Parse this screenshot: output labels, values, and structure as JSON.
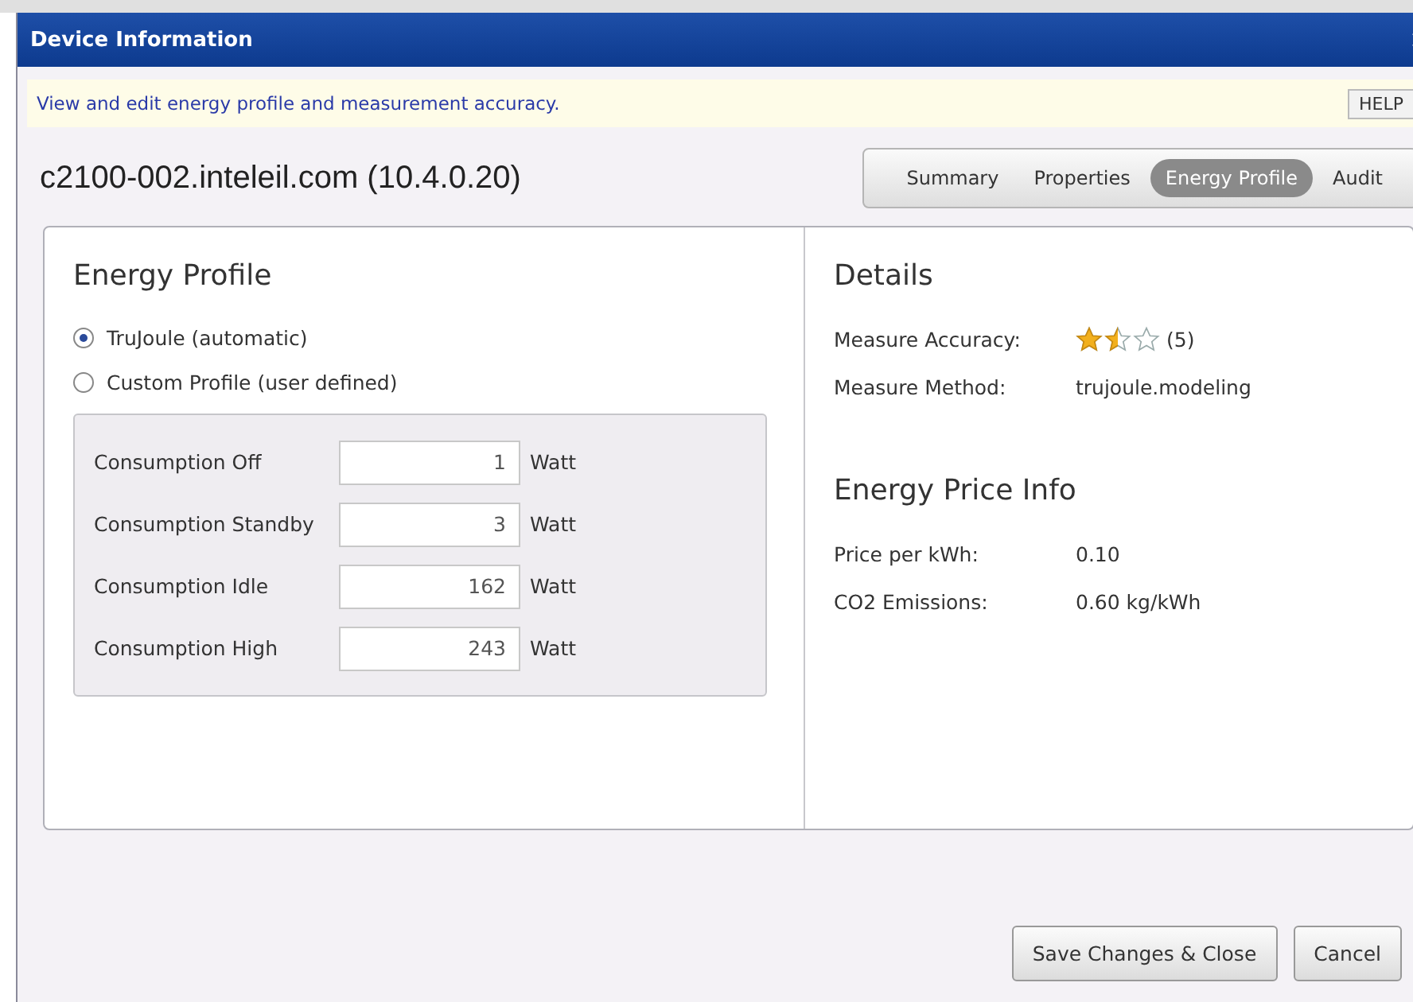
{
  "window": {
    "title": "Device Information"
  },
  "info_bar": {
    "text": "View and edit energy profile and measurement accuracy.",
    "help_button": "HELP"
  },
  "device_title": "c2100-002.inteleil.com (10.4.0.20)",
  "tabs": [
    {
      "label": "Summary",
      "selected": false
    },
    {
      "label": "Properties",
      "selected": false
    },
    {
      "label": "Energy Profile",
      "selected": true
    },
    {
      "label": "Audit",
      "selected": false
    }
  ],
  "energy_profile": {
    "heading": "Energy Profile",
    "options": [
      {
        "label": "TruJoule (automatic)",
        "selected": true
      },
      {
        "label": "Custom Profile (user defined)",
        "selected": false
      }
    ],
    "consumption": [
      {
        "label": "Consumption Off",
        "value": "1",
        "unit": "Watt"
      },
      {
        "label": "Consumption Standby",
        "value": "3",
        "unit": "Watt"
      },
      {
        "label": "Consumption Idle",
        "value": "162",
        "unit": "Watt"
      },
      {
        "label": "Consumption High",
        "value": "243",
        "unit": "Watt"
      }
    ]
  },
  "details": {
    "heading": "Details",
    "rows": [
      {
        "kind": "rating",
        "label": "Measure Accuracy:",
        "stars": 1.5,
        "value": "(5)"
      },
      {
        "kind": "text",
        "label": "Measure Method:",
        "value": "trujoule.modeling"
      }
    ]
  },
  "price_info": {
    "heading": "Energy Price Info",
    "rows": [
      {
        "label": "Price per kWh:",
        "value": "0.10"
      },
      {
        "label": "CO2 Emissions:",
        "value": "0.60 kg/kWh"
      }
    ]
  },
  "buttons": [
    "Save Changes & Close",
    "Cancel"
  ]
}
